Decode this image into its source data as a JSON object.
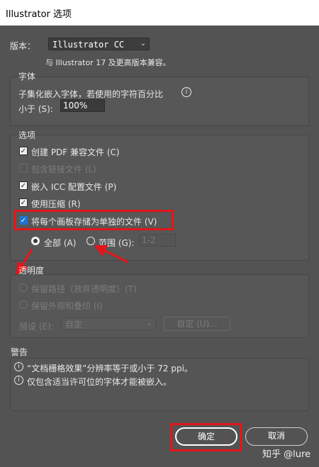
{
  "window": {
    "title": "Illustrator 选项"
  },
  "version": {
    "label": "版本：",
    "selected": "Illustrator CC",
    "note": "与 Illustrator 17 及更高版本兼容。"
  },
  "fonts": {
    "title": "字体",
    "subset_text": "子集化嵌入字体，若使用的字符百分比",
    "less_than": "小于 (S):",
    "percent_value": "100%"
  },
  "options": {
    "title": "选项",
    "items": [
      {
        "label": "创建 PDF 兼容文件 (C)",
        "checked": true,
        "enabled": true
      },
      {
        "label": "包含链接文件 (L)",
        "checked": false,
        "enabled": false
      },
      {
        "label": "嵌入 ICC 配置文件 (P)",
        "checked": true,
        "enabled": true
      },
      {
        "label": "使用压缩 (R)",
        "checked": true,
        "enabled": true
      },
      {
        "label": "将每个画板存储为单独的文件 (V)",
        "checked": true,
        "enabled": true
      }
    ],
    "radio_all": "全部 (A)",
    "radio_range": "范围 (G):",
    "range_value": "1-2"
  },
  "transparency": {
    "title": "透明度",
    "preserve_paths": "保留路径（放弃透明度）(T)",
    "preserve_appearance": "保留外观和叠印 (I)",
    "preset_label": "预设 (E):",
    "preset_value": "自定",
    "custom_button": "自定 (U)..."
  },
  "warnings": {
    "title": "警告",
    "items": [
      "“文档栅格效果”分辨率等于或小于 72 ppi。",
      "仅包含适当许可位的字体才能被嵌入。"
    ]
  },
  "buttons": {
    "ok": "确定",
    "cancel": "取消"
  },
  "watermark": "知乎 @lure",
  "colors": {
    "background": "#535353",
    "highlight_red": "#e2161a",
    "checkbox_blue": "#1f73d1"
  }
}
